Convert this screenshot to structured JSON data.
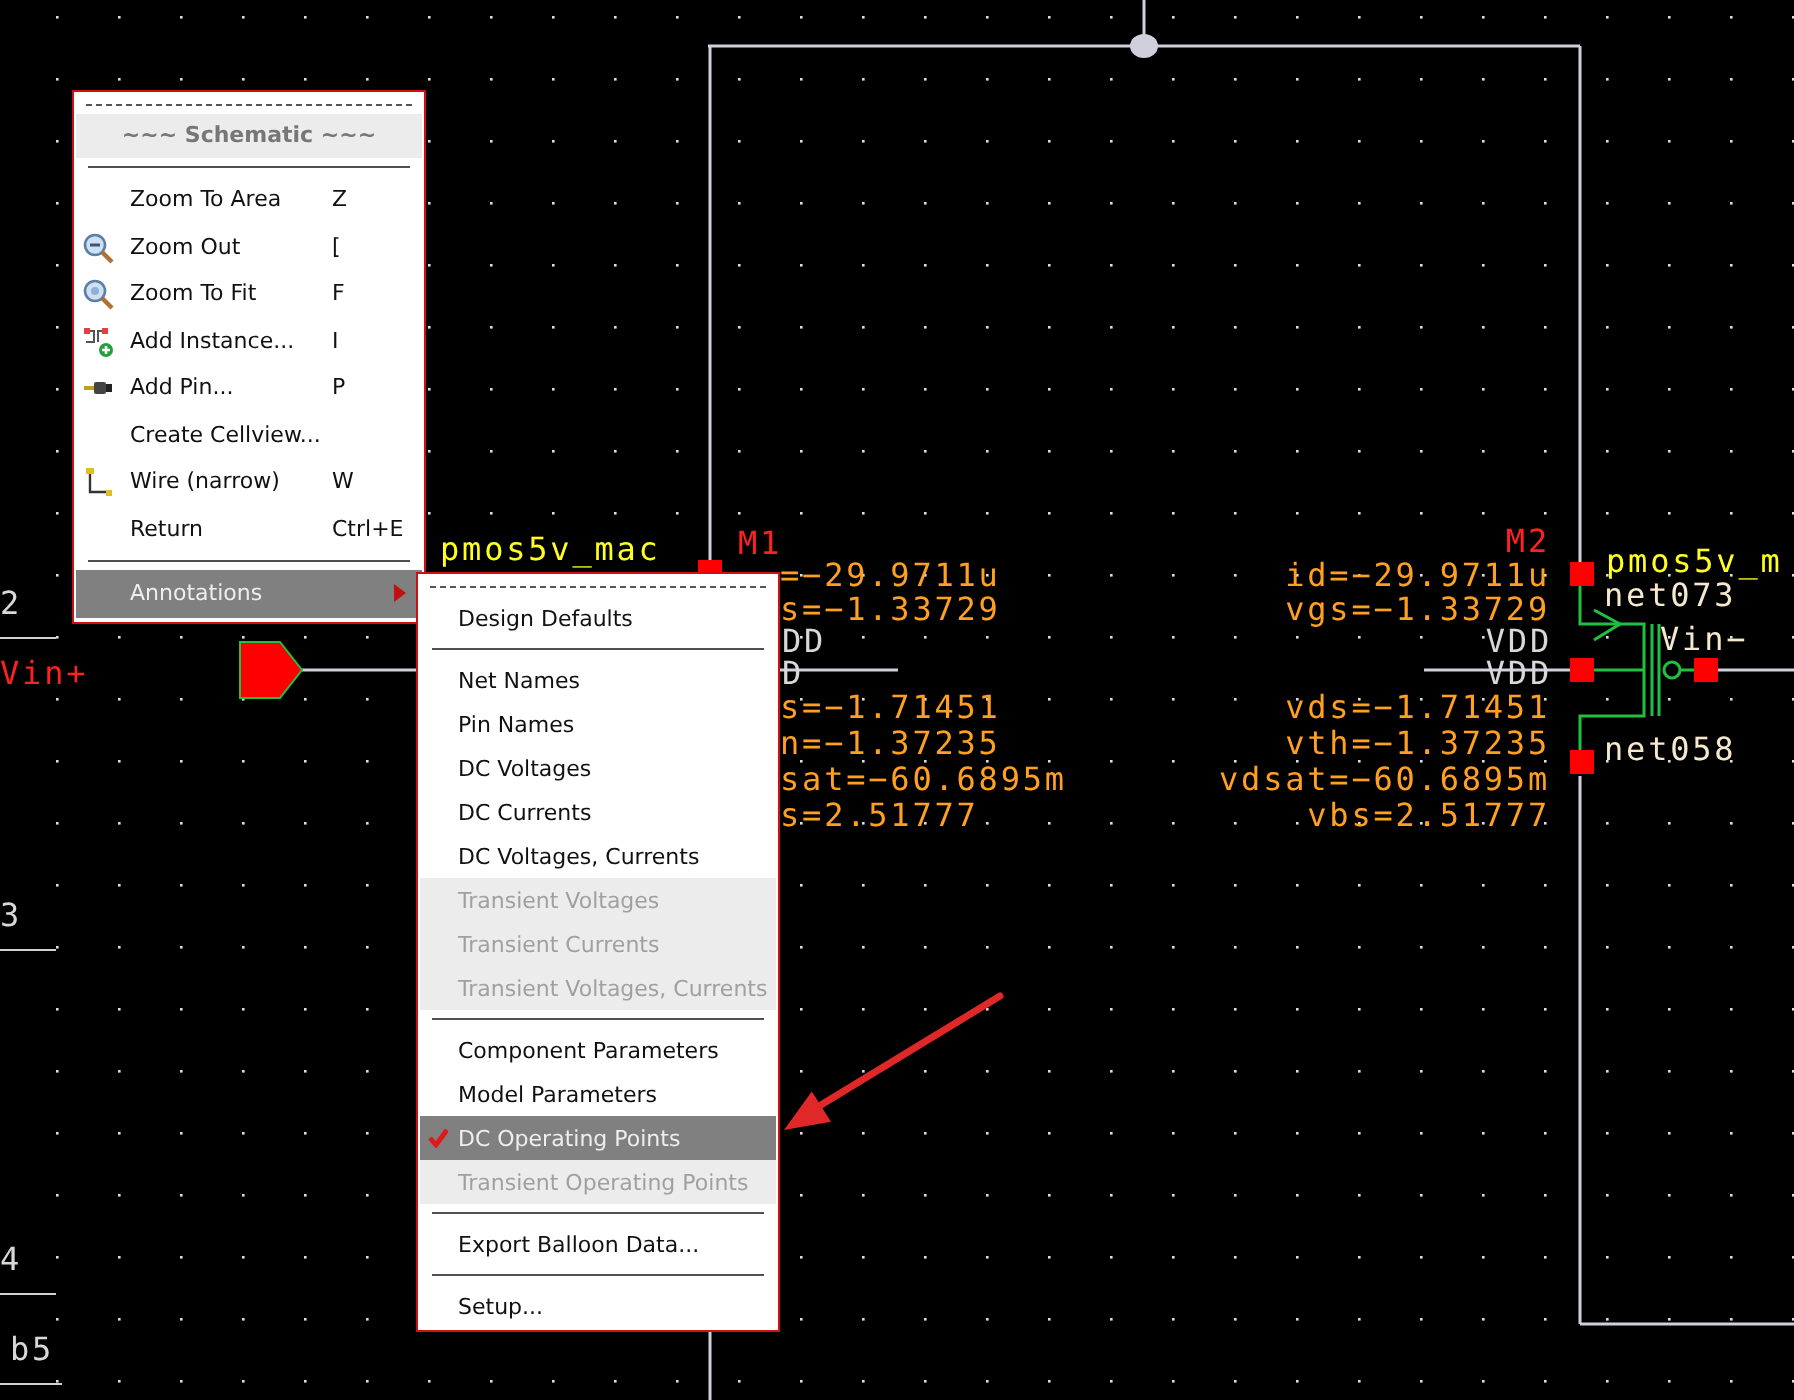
{
  "schematic": {
    "sheet_labels": [
      "2",
      "3",
      "4",
      "b5"
    ],
    "pins": [
      {
        "label": "Vin+"
      }
    ],
    "instances": [
      {
        "name": "M1",
        "cell": "pmos5v_mac",
        "params": [
          "=−29.9711u",
          "s=−1.33729",
          "s=−1.71451",
          "n=−1.37235",
          "sat=−60.6895m",
          "s=2.51777"
        ]
      },
      {
        "name": "M2",
        "cell": "pmos5v_m",
        "params": [
          "id=−29.9711u",
          "vgs=−1.33729",
          "vds=−1.71451",
          "vth=−1.37235",
          "vdsat=−60.6895m",
          "vbs=2.51777"
        ]
      }
    ],
    "net_labels": [
      {
        "label": "DD",
        "kind": "supply"
      },
      {
        "label": "D",
        "kind": "supply"
      },
      {
        "label": "net073",
        "kind": "net"
      },
      {
        "label": "VDD",
        "kind": "supply"
      },
      {
        "label": "Vin−",
        "kind": "net"
      },
      {
        "label": "VDD",
        "kind": "supply"
      },
      {
        "label": "net058",
        "kind": "net"
      }
    ]
  },
  "context_menu": {
    "title": "~~~ Schematic ~~~",
    "items": [
      {
        "kind": "item",
        "label": "Zoom To Area",
        "shortcut": "Z",
        "selected": false
      },
      {
        "kind": "item",
        "label": "Zoom Out",
        "shortcut": "[",
        "selected": false
      },
      {
        "kind": "item",
        "label": "Zoom To Fit",
        "shortcut": "F",
        "selected": false
      },
      {
        "kind": "item",
        "label": "Add Instance...",
        "shortcut": "I",
        "selected": false
      },
      {
        "kind": "item",
        "label": "Add Pin...",
        "shortcut": "P",
        "selected": false
      },
      {
        "kind": "item",
        "label": "Create Cellview...",
        "selected": false
      },
      {
        "kind": "item",
        "label": "Wire (narrow)",
        "shortcut": "W",
        "selected": false
      },
      {
        "kind": "item",
        "label": "Return",
        "shortcut": "Ctrl+E",
        "selected": false
      },
      {
        "kind": "separator"
      },
      {
        "kind": "submenu",
        "label": "Annotations",
        "selected": true
      }
    ]
  },
  "annotations_submenu": {
    "items": [
      {
        "kind": "item",
        "label": "Design Defaults",
        "selected": false,
        "disabled": false,
        "checked": false
      },
      {
        "kind": "separator"
      },
      {
        "kind": "item",
        "label": "Net Names",
        "selected": false,
        "disabled": false,
        "checked": false
      },
      {
        "kind": "item",
        "label": "Pin Names",
        "selected": false,
        "disabled": false,
        "checked": false
      },
      {
        "kind": "item",
        "label": "DC Voltages",
        "selected": false,
        "disabled": false,
        "checked": false
      },
      {
        "kind": "item",
        "label": "DC Currents",
        "selected": false,
        "disabled": false,
        "checked": false
      },
      {
        "kind": "item",
        "label": "DC Voltages, Currents",
        "selected": false,
        "disabled": false,
        "checked": false
      },
      {
        "kind": "item",
        "label": "Transient Voltages",
        "selected": false,
        "disabled": true,
        "checked": false
      },
      {
        "kind": "item",
        "label": "Transient Currents",
        "selected": false,
        "disabled": true,
        "checked": false
      },
      {
        "kind": "item",
        "label": "Transient Voltages, Currents",
        "selected": false,
        "disabled": true,
        "checked": false
      },
      {
        "kind": "separator"
      },
      {
        "kind": "item",
        "label": "Component Parameters",
        "selected": false,
        "disabled": false,
        "checked": false
      },
      {
        "kind": "item",
        "label": "Model Parameters",
        "selected": false,
        "disabled": false,
        "checked": false
      },
      {
        "kind": "item",
        "label": "DC Operating Points",
        "selected": true,
        "disabled": false,
        "checked": true
      },
      {
        "kind": "item",
        "label": "Transient Operating Points",
        "selected": false,
        "disabled": true,
        "checked": false
      },
      {
        "kind": "separator"
      },
      {
        "kind": "item",
        "label": "Export Balloon Data...",
        "selected": false,
        "disabled": false,
        "checked": false
      },
      {
        "kind": "separator"
      },
      {
        "kind": "item",
        "label": "Setup...",
        "selected": false,
        "disabled": false,
        "checked": false
      }
    ]
  }
}
